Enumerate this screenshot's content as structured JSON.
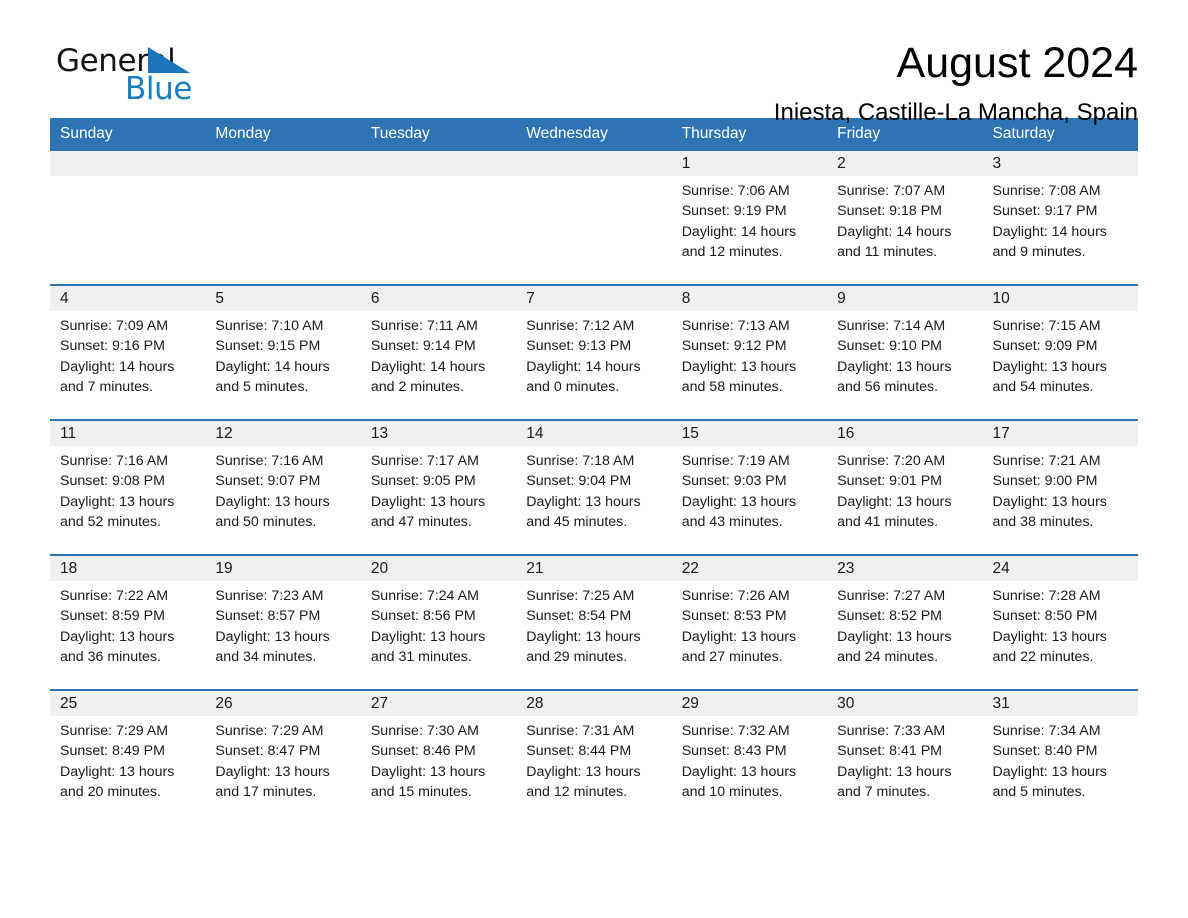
{
  "brand": {
    "name_part1": "General",
    "name_part2": "Blue",
    "flag_icon": "blue-triangle-flag-icon",
    "accent_color": "#1b75bb"
  },
  "header": {
    "title": "August 2024",
    "subtitle": "Iniesta, Castille-La Mancha, Spain"
  },
  "colors": {
    "header_band": "#2e74b5",
    "daynum_background": "#f0f0f0",
    "text": "#1a1a1a"
  },
  "labels": {
    "sunrise_prefix": "Sunrise:",
    "sunset_prefix": "Sunset:",
    "daylight_prefix": "Daylight:"
  },
  "weekday_headers": [
    "Sunday",
    "Monday",
    "Tuesday",
    "Wednesday",
    "Thursday",
    "Friday",
    "Saturday"
  ],
  "weeks": [
    [
      {
        "day": "",
        "sunrise": "",
        "sunset": "",
        "daylight_line1": "",
        "daylight_line2": "",
        "empty": true
      },
      {
        "day": "",
        "sunrise": "",
        "sunset": "",
        "daylight_line1": "",
        "daylight_line2": "",
        "empty": true
      },
      {
        "day": "",
        "sunrise": "",
        "sunset": "",
        "daylight_line1": "",
        "daylight_line2": "",
        "empty": true
      },
      {
        "day": "",
        "sunrise": "",
        "sunset": "",
        "daylight_line1": "",
        "daylight_line2": "",
        "empty": true
      },
      {
        "day": "1",
        "sunrise": "Sunrise: 7:06 AM",
        "sunset": "Sunset: 9:19 PM",
        "daylight_line1": "Daylight: 14 hours",
        "daylight_line2": "and 12 minutes.",
        "empty": false
      },
      {
        "day": "2",
        "sunrise": "Sunrise: 7:07 AM",
        "sunset": "Sunset: 9:18 PM",
        "daylight_line1": "Daylight: 14 hours",
        "daylight_line2": "and 11 minutes.",
        "empty": false
      },
      {
        "day": "3",
        "sunrise": "Sunrise: 7:08 AM",
        "sunset": "Sunset: 9:17 PM",
        "daylight_line1": "Daylight: 14 hours",
        "daylight_line2": "and 9 minutes.",
        "empty": false
      }
    ],
    [
      {
        "day": "4",
        "sunrise": "Sunrise: 7:09 AM",
        "sunset": "Sunset: 9:16 PM",
        "daylight_line1": "Daylight: 14 hours",
        "daylight_line2": "and 7 minutes.",
        "empty": false
      },
      {
        "day": "5",
        "sunrise": "Sunrise: 7:10 AM",
        "sunset": "Sunset: 9:15 PM",
        "daylight_line1": "Daylight: 14 hours",
        "daylight_line2": "and 5 minutes.",
        "empty": false
      },
      {
        "day": "6",
        "sunrise": "Sunrise: 7:11 AM",
        "sunset": "Sunset: 9:14 PM",
        "daylight_line1": "Daylight: 14 hours",
        "daylight_line2": "and 2 minutes.",
        "empty": false
      },
      {
        "day": "7",
        "sunrise": "Sunrise: 7:12 AM",
        "sunset": "Sunset: 9:13 PM",
        "daylight_line1": "Daylight: 14 hours",
        "daylight_line2": "and 0 minutes.",
        "empty": false
      },
      {
        "day": "8",
        "sunrise": "Sunrise: 7:13 AM",
        "sunset": "Sunset: 9:12 PM",
        "daylight_line1": "Daylight: 13 hours",
        "daylight_line2": "and 58 minutes.",
        "empty": false
      },
      {
        "day": "9",
        "sunrise": "Sunrise: 7:14 AM",
        "sunset": "Sunset: 9:10 PM",
        "daylight_line1": "Daylight: 13 hours",
        "daylight_line2": "and 56 minutes.",
        "empty": false
      },
      {
        "day": "10",
        "sunrise": "Sunrise: 7:15 AM",
        "sunset": "Sunset: 9:09 PM",
        "daylight_line1": "Daylight: 13 hours",
        "daylight_line2": "and 54 minutes.",
        "empty": false
      }
    ],
    [
      {
        "day": "11",
        "sunrise": "Sunrise: 7:16 AM",
        "sunset": "Sunset: 9:08 PM",
        "daylight_line1": "Daylight: 13 hours",
        "daylight_line2": "and 52 minutes.",
        "empty": false
      },
      {
        "day": "12",
        "sunrise": "Sunrise: 7:16 AM",
        "sunset": "Sunset: 9:07 PM",
        "daylight_line1": "Daylight: 13 hours",
        "daylight_line2": "and 50 minutes.",
        "empty": false
      },
      {
        "day": "13",
        "sunrise": "Sunrise: 7:17 AM",
        "sunset": "Sunset: 9:05 PM",
        "daylight_line1": "Daylight: 13 hours",
        "daylight_line2": "and 47 minutes.",
        "empty": false
      },
      {
        "day": "14",
        "sunrise": "Sunrise: 7:18 AM",
        "sunset": "Sunset: 9:04 PM",
        "daylight_line1": "Daylight: 13 hours",
        "daylight_line2": "and 45 minutes.",
        "empty": false
      },
      {
        "day": "15",
        "sunrise": "Sunrise: 7:19 AM",
        "sunset": "Sunset: 9:03 PM",
        "daylight_line1": "Daylight: 13 hours",
        "daylight_line2": "and 43 minutes.",
        "empty": false
      },
      {
        "day": "16",
        "sunrise": "Sunrise: 7:20 AM",
        "sunset": "Sunset: 9:01 PM",
        "daylight_line1": "Daylight: 13 hours",
        "daylight_line2": "and 41 minutes.",
        "empty": false
      },
      {
        "day": "17",
        "sunrise": "Sunrise: 7:21 AM",
        "sunset": "Sunset: 9:00 PM",
        "daylight_line1": "Daylight: 13 hours",
        "daylight_line2": "and 38 minutes.",
        "empty": false
      }
    ],
    [
      {
        "day": "18",
        "sunrise": "Sunrise: 7:22 AM",
        "sunset": "Sunset: 8:59 PM",
        "daylight_line1": "Daylight: 13 hours",
        "daylight_line2": "and 36 minutes.",
        "empty": false
      },
      {
        "day": "19",
        "sunrise": "Sunrise: 7:23 AM",
        "sunset": "Sunset: 8:57 PM",
        "daylight_line1": "Daylight: 13 hours",
        "daylight_line2": "and 34 minutes.",
        "empty": false
      },
      {
        "day": "20",
        "sunrise": "Sunrise: 7:24 AM",
        "sunset": "Sunset: 8:56 PM",
        "daylight_line1": "Daylight: 13 hours",
        "daylight_line2": "and 31 minutes.",
        "empty": false
      },
      {
        "day": "21",
        "sunrise": "Sunrise: 7:25 AM",
        "sunset": "Sunset: 8:54 PM",
        "daylight_line1": "Daylight: 13 hours",
        "daylight_line2": "and 29 minutes.",
        "empty": false
      },
      {
        "day": "22",
        "sunrise": "Sunrise: 7:26 AM",
        "sunset": "Sunset: 8:53 PM",
        "daylight_line1": "Daylight: 13 hours",
        "daylight_line2": "and 27 minutes.",
        "empty": false
      },
      {
        "day": "23",
        "sunrise": "Sunrise: 7:27 AM",
        "sunset": "Sunset: 8:52 PM",
        "daylight_line1": "Daylight: 13 hours",
        "daylight_line2": "and 24 minutes.",
        "empty": false
      },
      {
        "day": "24",
        "sunrise": "Sunrise: 7:28 AM",
        "sunset": "Sunset: 8:50 PM",
        "daylight_line1": "Daylight: 13 hours",
        "daylight_line2": "and 22 minutes.",
        "empty": false
      }
    ],
    [
      {
        "day": "25",
        "sunrise": "Sunrise: 7:29 AM",
        "sunset": "Sunset: 8:49 PM",
        "daylight_line1": "Daylight: 13 hours",
        "daylight_line2": "and 20 minutes.",
        "empty": false
      },
      {
        "day": "26",
        "sunrise": "Sunrise: 7:29 AM",
        "sunset": "Sunset: 8:47 PM",
        "daylight_line1": "Daylight: 13 hours",
        "daylight_line2": "and 17 minutes.",
        "empty": false
      },
      {
        "day": "27",
        "sunrise": "Sunrise: 7:30 AM",
        "sunset": "Sunset: 8:46 PM",
        "daylight_line1": "Daylight: 13 hours",
        "daylight_line2": "and 15 minutes.",
        "empty": false
      },
      {
        "day": "28",
        "sunrise": "Sunrise: 7:31 AM",
        "sunset": "Sunset: 8:44 PM",
        "daylight_line1": "Daylight: 13 hours",
        "daylight_line2": "and 12 minutes.",
        "empty": false
      },
      {
        "day": "29",
        "sunrise": "Sunrise: 7:32 AM",
        "sunset": "Sunset: 8:43 PM",
        "daylight_line1": "Daylight: 13 hours",
        "daylight_line2": "and 10 minutes.",
        "empty": false
      },
      {
        "day": "30",
        "sunrise": "Sunrise: 7:33 AM",
        "sunset": "Sunset: 8:41 PM",
        "daylight_line1": "Daylight: 13 hours",
        "daylight_line2": "and 7 minutes.",
        "empty": false
      },
      {
        "day": "31",
        "sunrise": "Sunrise: 7:34 AM",
        "sunset": "Sunset: 8:40 PM",
        "daylight_line1": "Daylight: 13 hours",
        "daylight_line2": "and 5 minutes.",
        "empty": false
      }
    ]
  ]
}
